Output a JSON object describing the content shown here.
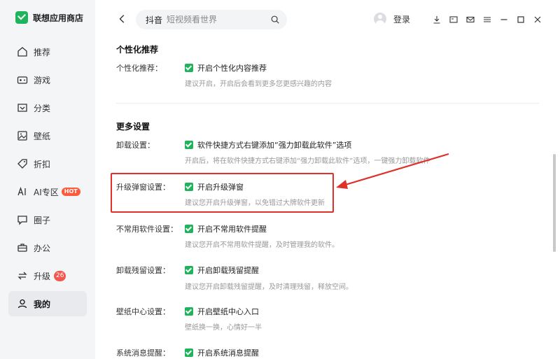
{
  "app": {
    "name": "联想应用商店"
  },
  "sidebar": {
    "items": [
      {
        "label": "推荐",
        "icon": "home-icon"
      },
      {
        "label": "游戏",
        "icon": "game-icon"
      },
      {
        "label": "分类",
        "icon": "category-icon"
      },
      {
        "label": "壁纸",
        "icon": "wallpaper-icon"
      },
      {
        "label": "折扣",
        "icon": "tag-icon"
      },
      {
        "label": "AI专区",
        "icon": "ai-icon",
        "badge": "HOT"
      },
      {
        "label": "圈子",
        "icon": "chat-icon"
      },
      {
        "label": "办公",
        "icon": "briefcase-icon"
      },
      {
        "label": "升级",
        "icon": "upgrade-icon",
        "badge": "26"
      },
      {
        "label": "我的",
        "icon": "user-icon",
        "active": true
      }
    ]
  },
  "header": {
    "search": {
      "keyword": "抖音",
      "placeholder": "短视频看世界"
    },
    "login_label": "登录"
  },
  "settings": {
    "personal": {
      "title": "个性化推荐",
      "label": "个性化推荐：",
      "option": "开启个性化内容推荐",
      "desc": "建议开启，开启后会看到更多您更感兴趣的内容"
    },
    "more_title": "更多设置",
    "uninstall": {
      "label": "卸载设置：",
      "option": "软件快捷方式右键添加“强力卸载此软件”选项",
      "desc": "开启后，将在软件快捷方式右键添加“强力卸载此软件”选项，一键强力卸载软件"
    },
    "upgrade_popup": {
      "label": "升级弹窗设置：",
      "option": "开启升级弹窗",
      "desc": "建议您开启升级弹窗，以免错过大牌软件更新"
    },
    "rare_software": {
      "label": "不常用软件设置：",
      "option": "开启不常用软件提醒",
      "desc": "建议您开启不常用软件提醒，及时管理我的软件。"
    },
    "residue": {
      "label": "卸载残留设置：",
      "option": "开启卸载残留提醒",
      "desc": "建议您开启卸载残留提醒，及时清理残留，释放空间。"
    },
    "wallpaper_center": {
      "label": "壁纸中心设置：",
      "option": "开启壁纸中心入口",
      "desc": "壁纸换一换，心情好一半"
    },
    "system_msg": {
      "label": "系统消息提醒：",
      "option": "开启系统消息提醒"
    }
  },
  "colors": {
    "accent": "#1fb35b",
    "highlight": "#e0302a"
  }
}
